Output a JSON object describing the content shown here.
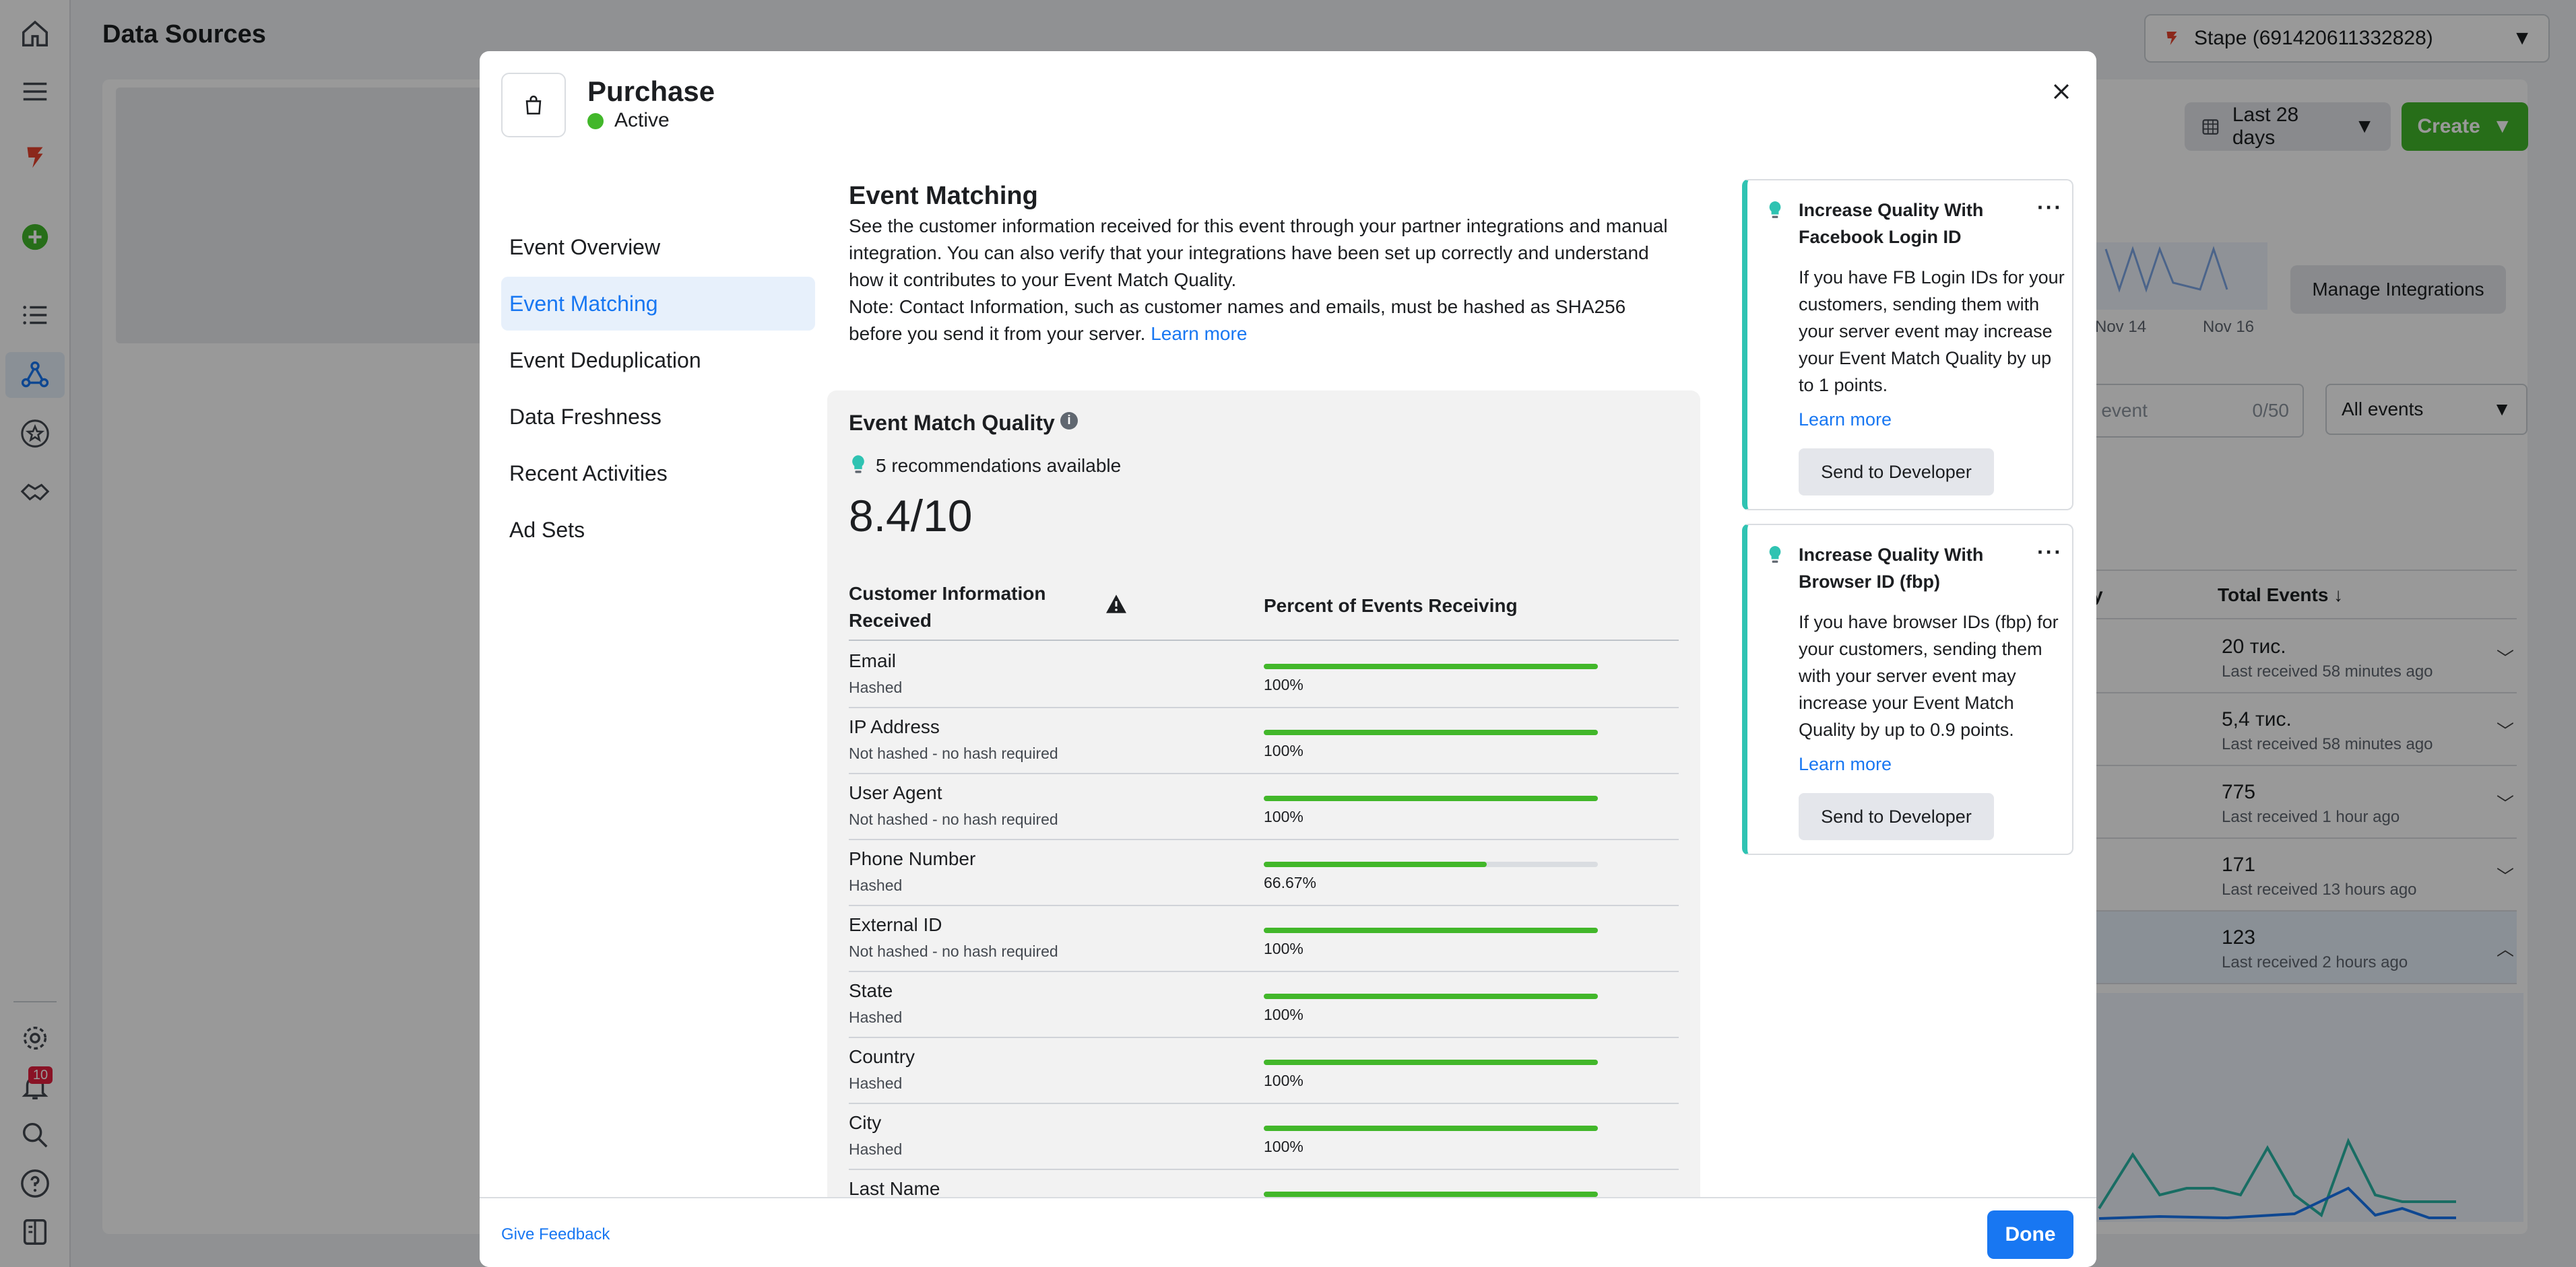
{
  "page": {
    "title": "Data Sources",
    "account": "Stape (691420611332828)",
    "date_range": "Last 28 days",
    "create_label": "Create",
    "manage_integrations": "Manage Integrations",
    "search_placeholder": "by event",
    "search_count": "0/50",
    "events_filter": "All events",
    "chart_labels": [
      "Nov 14",
      "Nov 16"
    ],
    "notifications_count": "10",
    "table_headers": {
      "by": "y",
      "total": "Total Events ↓"
    },
    "table_rows": [
      {
        "value": "20 тис.",
        "last": "Last received 58 minutes ago"
      },
      {
        "value": "5,4 тис.",
        "last": "Last received 58 minutes ago"
      },
      {
        "value": "775",
        "last": "Last received 1 hour ago"
      },
      {
        "value": "171",
        "last": "Last received 13 hours ago"
      },
      {
        "value": "123",
        "last": "Last received 2 hours ago"
      }
    ]
  },
  "modal": {
    "title": "Purchase",
    "status": "Active",
    "status_color": "#42b72a",
    "nav": [
      {
        "label": "Event Overview"
      },
      {
        "label": "Event Matching",
        "active": true
      },
      {
        "label": "Event Deduplication"
      },
      {
        "label": "Data Freshness"
      },
      {
        "label": "Recent Activities"
      },
      {
        "label": "Ad Sets"
      }
    ],
    "section_title": "Event Matching",
    "description": "See the customer information received for this event through your partner integrations and manual integration. You can also verify that your integrations have been set up correctly and understand how it contributes to your Event Match Quality.",
    "note": "Note: Contact Information, such as customer names and emails, must be hashed as SHA256 before you send it from your server.",
    "learn_more": "Learn more",
    "emq": {
      "title": "Event Match Quality",
      "recommendations": "5 recommendations available",
      "score": "8.4/10",
      "col_customer_info": "Customer Information Received",
      "col_percent": "Percent of Events Receiving",
      "rows": [
        {
          "name": "Email",
          "hash": "Hashed",
          "percent": 100,
          "percent_label": "100%"
        },
        {
          "name": "IP Address",
          "hash": "Not hashed - no hash required",
          "percent": 100,
          "percent_label": "100%"
        },
        {
          "name": "User Agent",
          "hash": "Not hashed - no hash required",
          "percent": 100,
          "percent_label": "100%"
        },
        {
          "name": "Phone Number",
          "hash": "Hashed",
          "percent": 66.67,
          "percent_label": "66.67%"
        },
        {
          "name": "External ID",
          "hash": "Not hashed - no hash required",
          "percent": 100,
          "percent_label": "100%"
        },
        {
          "name": "State",
          "hash": "Hashed",
          "percent": 100,
          "percent_label": "100%"
        },
        {
          "name": "Country",
          "hash": "Hashed",
          "percent": 100,
          "percent_label": "100%"
        },
        {
          "name": "City",
          "hash": "Hashed",
          "percent": 100,
          "percent_label": "100%"
        },
        {
          "name": "Last Name",
          "hash": "",
          "percent": 100,
          "percent_label": ""
        }
      ]
    },
    "recommendations": [
      {
        "title": "Increase Quality With Facebook Login ID",
        "body": "If you have FB Login IDs for your customers, sending them with your server event may increase your Event Match Quality by up to 1 points.",
        "link": "Learn more",
        "button": "Send to Developer"
      },
      {
        "title": "Increase Quality With Browser ID (fbp)",
        "body": "If you have browser IDs (fbp) for your customers, sending them with your server event may increase your Event Match Quality by up to 0.9 points.",
        "link": "Learn more",
        "button": "Send to Developer"
      }
    ],
    "feedback": "Give Feedback",
    "done": "Done"
  },
  "colors": {
    "accent": "#1877f2",
    "success": "#42b72a",
    "teal": "#2fc3b2",
    "overlay": "rgba(0,0,0,0.40)"
  }
}
